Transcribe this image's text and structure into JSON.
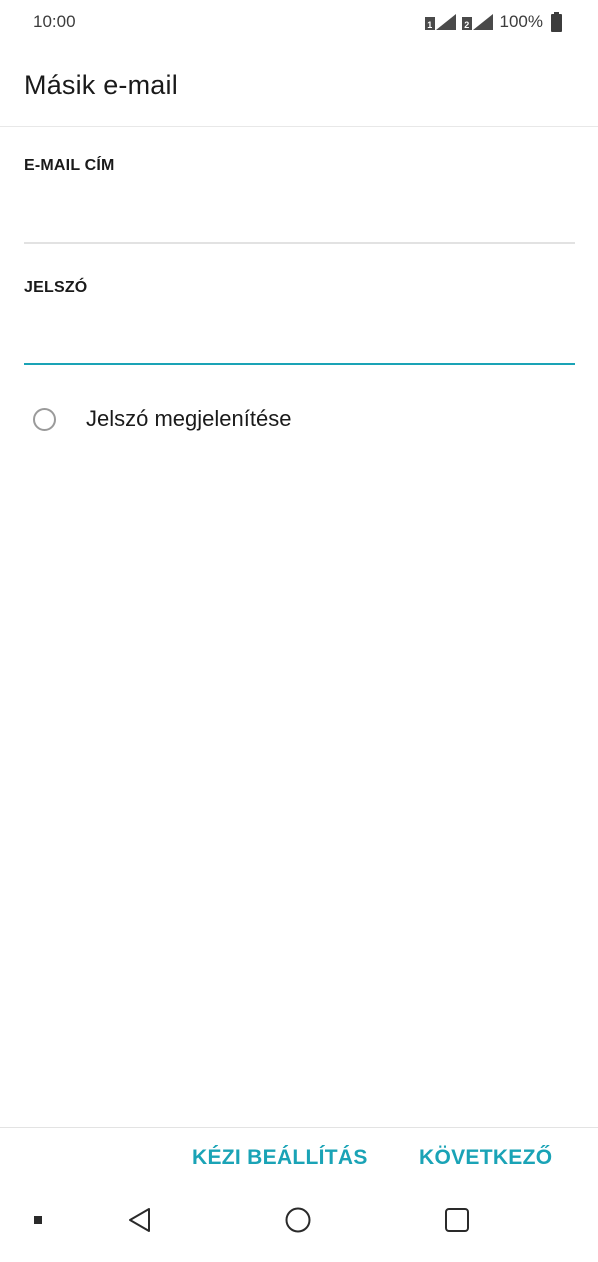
{
  "status_bar": {
    "time": "10:00",
    "battery": "100%",
    "icons": [
      "sim1-signal-icon",
      "sim2-signal-icon",
      "battery-icon"
    ]
  },
  "app_bar": {
    "title": "Másik e-mail"
  },
  "form": {
    "email_label": "E-MAIL CÍM",
    "email_value": "",
    "password_label": "JELSZÓ",
    "password_value": "",
    "show_password_label": "Jelszó megjelenítése",
    "show_password_checked": false
  },
  "actions": {
    "manual_setup_label": "KÉZI BEÁLLÍTÁS",
    "next_label": "KÖVETKEZŐ"
  },
  "nav_bar": {
    "icons": [
      "notification-dot-icon",
      "back-icon",
      "home-icon",
      "recent-apps-icon"
    ]
  },
  "colors": {
    "accent": "#1aa3b6",
    "text": "#1a1a1a",
    "divider": "#e3e3e3"
  }
}
